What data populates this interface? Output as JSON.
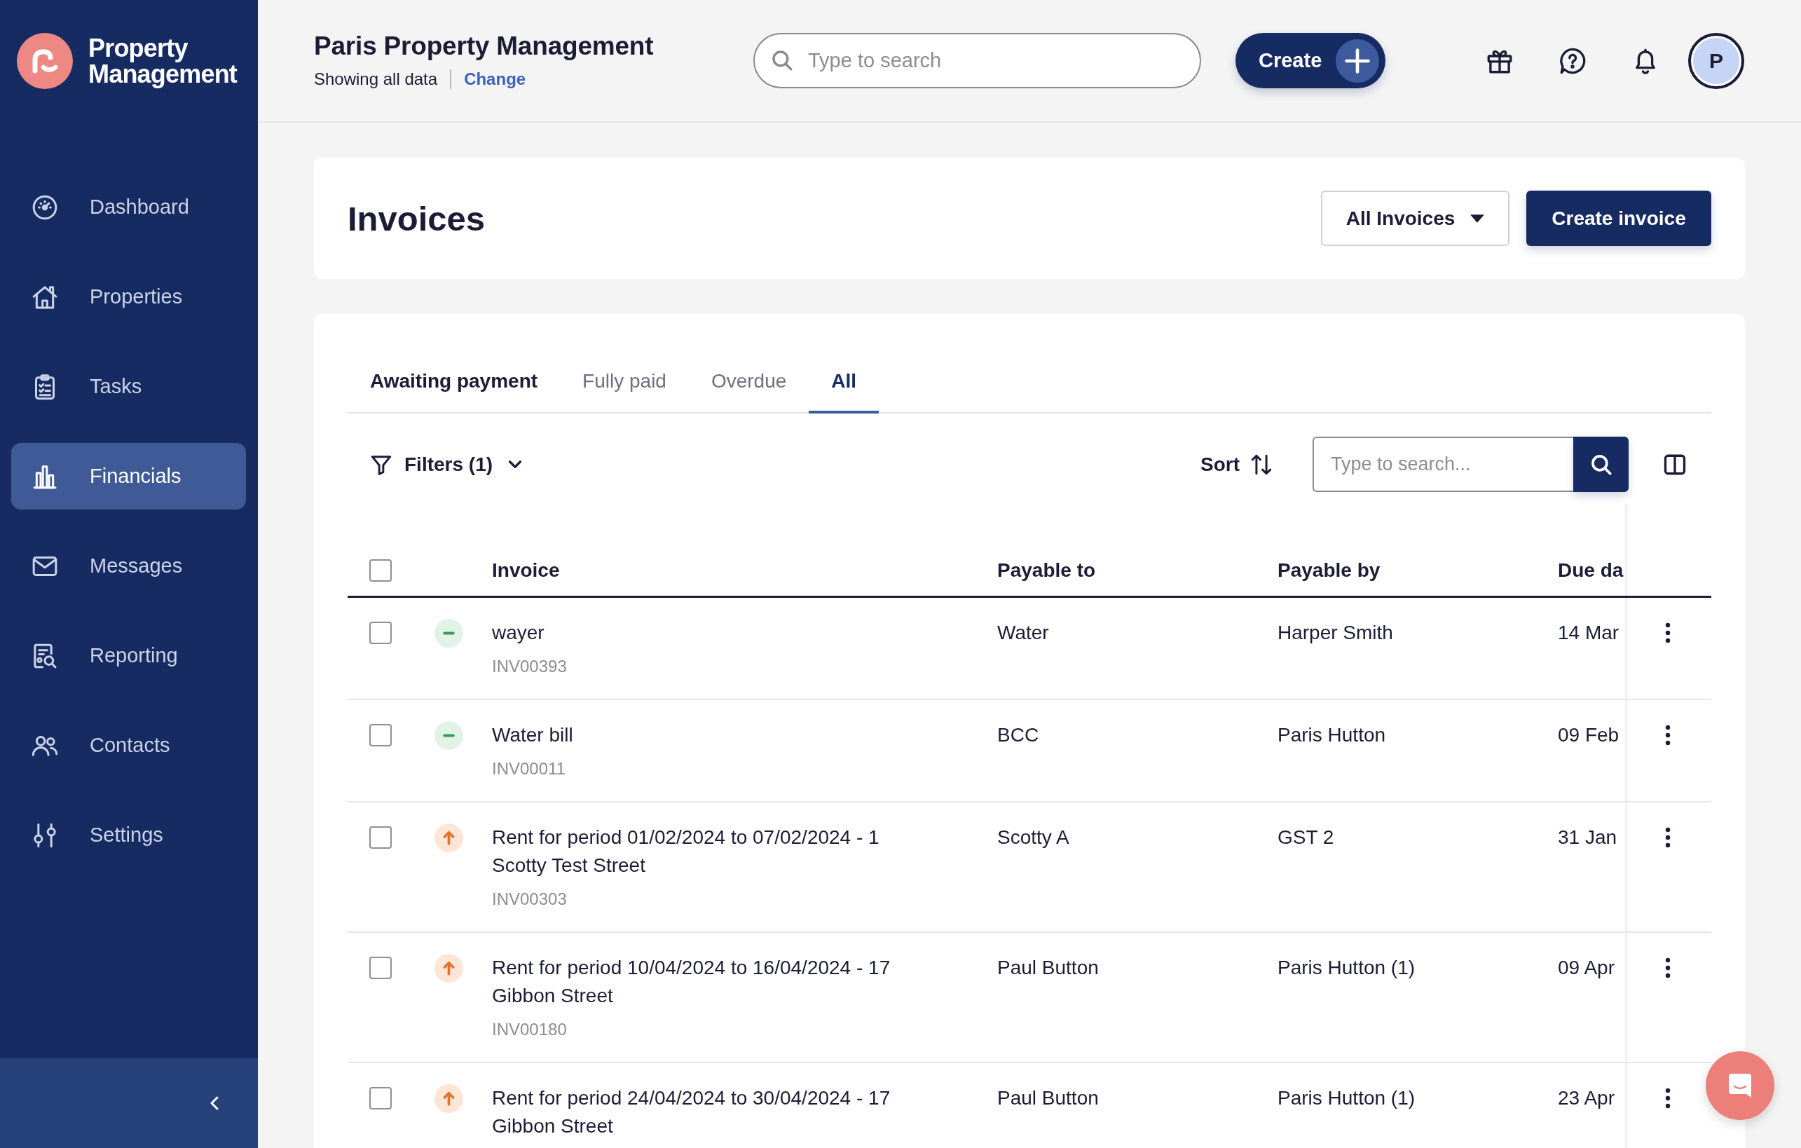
{
  "sidebar": {
    "app_name": "Property Management",
    "items": [
      {
        "label": "Dashboard",
        "selected": false
      },
      {
        "label": "Properties",
        "selected": false
      },
      {
        "label": "Tasks",
        "selected": false
      },
      {
        "label": "Financials",
        "selected": true
      },
      {
        "label": "Messages",
        "selected": false
      },
      {
        "label": "Reporting",
        "selected": false
      },
      {
        "label": "Contacts",
        "selected": false
      },
      {
        "label": "Settings",
        "selected": false
      }
    ]
  },
  "header": {
    "title": "Paris Property Management",
    "scope_text": "Showing all data",
    "change_link": "Change",
    "search": {
      "placeholder": "Type to search"
    },
    "create_button": "Create",
    "avatar_initial": "P"
  },
  "page": {
    "title": "Invoices",
    "view_dropdown": "All Invoices",
    "create_button": "Create invoice"
  },
  "tabs": [
    {
      "label": "Awaiting payment",
      "selected": false,
      "hovered": true
    },
    {
      "label": "Fully paid",
      "selected": false,
      "hovered": false
    },
    {
      "label": "Overdue",
      "selected": false,
      "hovered": false
    },
    {
      "label": "All",
      "selected": true,
      "hovered": false
    }
  ],
  "toolbar": {
    "filters": "Filters (1)",
    "sort": "Sort",
    "search": {
      "placeholder": "Type to search..."
    }
  },
  "table": {
    "select_all": {
      "checked": false
    },
    "columns": [
      "Invoice",
      "Payable to",
      "Payable by",
      "Due da"
    ],
    "rows": [
      {
        "checked": false,
        "kind": "minus",
        "title": "wayer",
        "number": "INV00393",
        "payable_to": "Water",
        "payable_by": "Harper Smith",
        "due": "14 Mar"
      },
      {
        "checked": false,
        "kind": "minus",
        "title": "Water bill",
        "number": "INV00011",
        "payable_to": "BCC",
        "payable_by": "Paris Hutton",
        "due": "09 Feb"
      },
      {
        "checked": false,
        "kind": "arrow",
        "title": "Rent for period 01/02/2024 to 07/02/2024 - 1 Scotty Test Street",
        "number": "INV00303",
        "payable_to": "Scotty A",
        "payable_by": "GST 2",
        "due": "31 Jan"
      },
      {
        "checked": false,
        "kind": "arrow",
        "title": "Rent for period 10/04/2024 to 16/04/2024 - 17 Gibbon Street",
        "number": "INV00180",
        "payable_to": "Paul Button",
        "payable_by": "Paris Hutton (1)",
        "due": "09 Apr"
      },
      {
        "checked": false,
        "kind": "arrow",
        "title": "Rent for period 24/04/2024 to 30/04/2024 - 17 Gibbon Street",
        "payable_to": "Paul Button",
        "payable_by": "Paris Hutton (1)",
        "due": "23 Apr"
      }
    ]
  }
}
